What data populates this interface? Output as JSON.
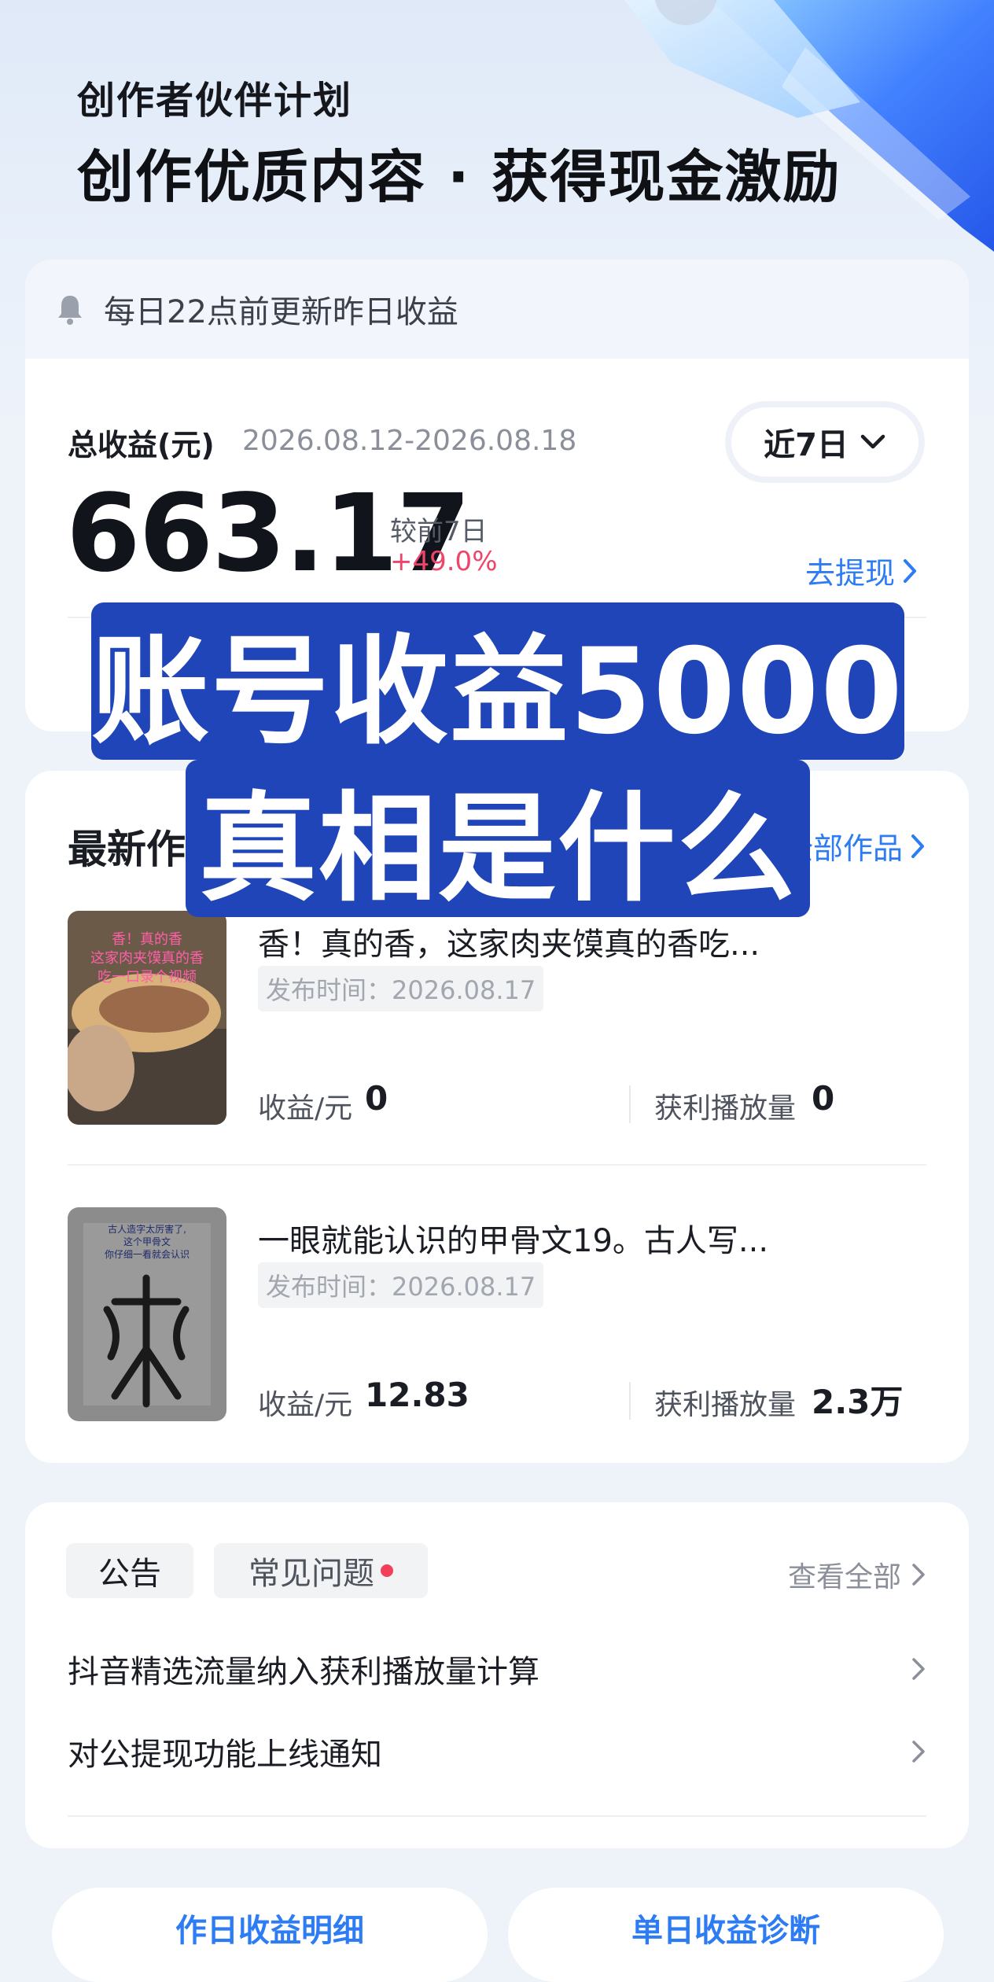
{
  "hero": {
    "subtitle": "创作者伙伴计划",
    "title": "创作优质内容 · 获得现金激励"
  },
  "earnings": {
    "notice": "每日22点前更新昨日收益",
    "total_label": "总收益(元)",
    "date_range": "2026.08.12-2026.08.18",
    "period": "近7日",
    "amount": "663.17",
    "compare_label": "较前7日",
    "compare_value": "+49.0%",
    "withdraw_label": "去提现"
  },
  "works": {
    "title": "最新作品",
    "all_label": "全部作品",
    "items": [
      {
        "title": "香！真的香，这家肉夹馍真的香吃...",
        "date": "发布时间：2026.08.17",
        "earn_label": "收益/元",
        "earn_value": "0",
        "play_label": "获利播放量",
        "play_value": "0",
        "thumb_text": [
          "香！真的香",
          "这家肉夹馍真的香",
          "吃一口录个视频"
        ]
      },
      {
        "title": "一眼就能认识的甲骨文19。古人写...",
        "date": "发布时间：2026.08.17",
        "earn_label": "收益/元",
        "earn_value": "12.83",
        "play_label": "获利播放量",
        "play_value": "2.3万",
        "thumb_text": [
          "古人造字太厉害了,",
          "这个甲骨文",
          "你仔细一看就会认识"
        ]
      }
    ]
  },
  "announcements": {
    "tab_ann": "公告",
    "tab_faq": "常见问题",
    "view_all": "查看全部",
    "items": [
      "抖音精选流量纳入获利播放量计算",
      "对公提现功能上线通知"
    ]
  },
  "bottom": {
    "left": "作日收益明细",
    "right": "单日收益诊断"
  },
  "overlay": {
    "line1": "账号收益5000",
    "line2": "真相是什么"
  },
  "colors": {
    "accent": "#2d7cf3",
    "positive": "#f0456a",
    "overlay_bg": "#2045b9"
  }
}
